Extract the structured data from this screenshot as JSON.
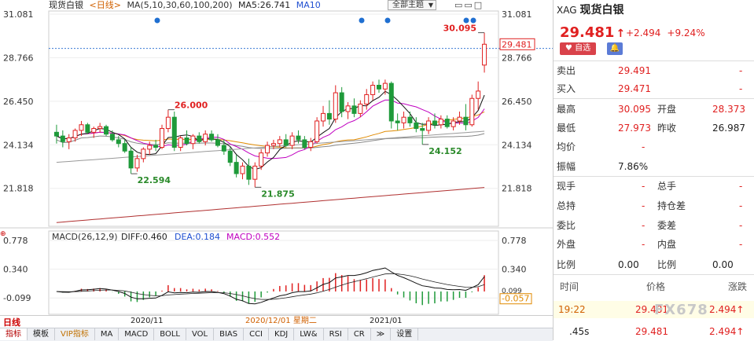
{
  "header": {
    "title": "现货白银",
    "period": "<日线>",
    "ma_label": "MA(5,10,30,60,100,200)",
    "ma5": "MA5:26.741",
    "ma10": "MA10",
    "theme_button": "全部主题",
    "window_buttons": "▭▭□"
  },
  "macd": {
    "label": "MACD(26,12,9)",
    "dif": "DIFF:0.460",
    "dea": "DEA:0.184",
    "macd": "MACD:0.552",
    "axis_ticks": [
      "0.778",
      "0.340",
      "-0.099"
    ],
    "right_ticks": [
      "0.778",
      "0.340",
      "0.099",
      "-0.057"
    ]
  },
  "chart_data": {
    "type": "candlestick",
    "y_ticks_left": [
      "31.081",
      "28.766",
      "26.450",
      "24.134",
      "21.818"
    ],
    "y_ticks_right": [
      "31.081",
      "28.766",
      "26.450",
      "24.134",
      "21.818"
    ],
    "ylim": [
      19.8,
      31.081
    ],
    "current_price_tag": "29.481",
    "annotations": [
      {
        "text": "30.095",
        "color": "#e02020"
      },
      {
        "text": "26.000",
        "color": "#e02020"
      },
      {
        "text": "22.594",
        "color": "#2a8a2a"
      },
      {
        "text": "21.875",
        "color": "#2a8a2a"
      },
      {
        "text": "24.152",
        "color": "#2a8a2a"
      }
    ],
    "x_labels": [
      "2020/11",
      "2020/12/01 星期二",
      "2021/01"
    ],
    "candles": [
      [
        24.8,
        25.2,
        24.2,
        24.6
      ],
      [
        24.6,
        24.9,
        24.0,
        24.3
      ],
      [
        24.3,
        24.7,
        23.9,
        24.5
      ],
      [
        24.5,
        25.0,
        24.3,
        24.9
      ],
      [
        24.9,
        25.4,
        24.6,
        25.2
      ],
      [
        25.2,
        25.3,
        24.7,
        24.8
      ],
      [
        24.8,
        25.1,
        24.5,
        25.0
      ],
      [
        25.0,
        25.3,
        24.8,
        25.1
      ],
      [
        25.1,
        25.2,
        24.6,
        24.7
      ],
      [
        24.7,
        24.9,
        24.3,
        24.4
      ],
      [
        24.4,
        24.6,
        24.0,
        24.2
      ],
      [
        24.2,
        24.4,
        23.7,
        23.8
      ],
      [
        23.8,
        24.0,
        22.6,
        22.9
      ],
      [
        22.9,
        23.6,
        22.7,
        23.4
      ],
      [
        23.4,
        24.0,
        23.2,
        23.9
      ],
      [
        23.9,
        24.3,
        23.6,
        24.1
      ],
      [
        24.1,
        24.4,
        23.8,
        24.0
      ],
      [
        24.0,
        25.2,
        23.9,
        25.0
      ],
      [
        25.0,
        26.0,
        24.8,
        25.6
      ],
      [
        25.6,
        25.9,
        23.8,
        24.0
      ],
      [
        24.0,
        24.6,
        23.8,
        24.5
      ],
      [
        24.5,
        24.9,
        24.1,
        24.2
      ],
      [
        24.2,
        24.7,
        23.9,
        24.6
      ],
      [
        24.6,
        24.8,
        24.2,
        24.3
      ],
      [
        24.3,
        24.9,
        24.1,
        24.7
      ],
      [
        24.7,
        24.9,
        24.3,
        24.4
      ],
      [
        24.4,
        24.7,
        24.0,
        24.1
      ],
      [
        24.1,
        24.4,
        23.6,
        23.8
      ],
      [
        23.8,
        24.0,
        23.0,
        23.2
      ],
      [
        23.2,
        23.6,
        22.4,
        22.6
      ],
      [
        22.6,
        23.2,
        22.3,
        23.0
      ],
      [
        23.0,
        23.4,
        22.0,
        22.3
      ],
      [
        22.3,
        23.2,
        21.875,
        23.0
      ],
      [
        23.0,
        23.9,
        22.8,
        23.7
      ],
      [
        23.7,
        24.3,
        23.5,
        24.1
      ],
      [
        24.1,
        24.4,
        23.9,
        24.2
      ],
      [
        24.2,
        24.6,
        24.0,
        24.4
      ],
      [
        24.4,
        24.7,
        24.0,
        24.1
      ],
      [
        24.1,
        24.8,
        23.9,
        24.6
      ],
      [
        24.6,
        24.9,
        24.2,
        24.4
      ],
      [
        24.4,
        24.6,
        23.9,
        24.0
      ],
      [
        24.0,
        24.5,
        23.8,
        24.3
      ],
      [
        24.3,
        25.6,
        24.2,
        25.4
      ],
      [
        25.4,
        26.2,
        25.1,
        25.8
      ],
      [
        25.8,
        26.5,
        25.2,
        25.5
      ],
      [
        25.5,
        27.3,
        25.3,
        26.9
      ],
      [
        26.9,
        27.2,
        25.6,
        25.9
      ],
      [
        25.9,
        26.4,
        25.5,
        26.2
      ],
      [
        26.2,
        26.6,
        25.6,
        25.8
      ],
      [
        25.8,
        26.5,
        25.6,
        26.3
      ],
      [
        26.3,
        27.1,
        26.0,
        26.8
      ],
      [
        26.8,
        27.5,
        26.5,
        27.3
      ],
      [
        27.3,
        27.6,
        26.9,
        27.1
      ],
      [
        27.1,
        27.6,
        26.8,
        27.4
      ],
      [
        27.4,
        27.5,
        25.0,
        25.4
      ],
      [
        25.4,
        25.8,
        24.9,
        25.3
      ],
      [
        25.3,
        25.9,
        25.0,
        25.6
      ],
      [
        25.6,
        25.9,
        25.1,
        25.3
      ],
      [
        25.3,
        25.6,
        24.8,
        25.0
      ],
      [
        25.0,
        25.3,
        24.152,
        24.9
      ],
      [
        24.9,
        25.6,
        24.7,
        25.4
      ],
      [
        25.4,
        25.8,
        25.0,
        25.2
      ],
      [
        25.2,
        25.7,
        25.0,
        25.5
      ],
      [
        25.5,
        25.7,
        25.0,
        25.1
      ],
      [
        25.1,
        25.6,
        24.9,
        25.4
      ],
      [
        25.4,
        25.9,
        25.2,
        25.6
      ],
      [
        25.6,
        26.3,
        24.9,
        25.2
      ],
      [
        25.2,
        26.8,
        25.1,
        26.6
      ],
      [
        26.6,
        27.5,
        26.0,
        26.99
      ],
      [
        28.373,
        30.095,
        27.973,
        29.481
      ]
    ]
  },
  "quote": {
    "code": "XAG",
    "name": "现货白银",
    "price": "29.481",
    "arrow": "↑",
    "change": "+2.494",
    "change_pct": "+9.24%",
    "btn_watch": "♥ 自选",
    "rows": [
      {
        "l1": "卖出",
        "v1": "29.491",
        "l2": "",
        "v2": "-"
      },
      {
        "l1": "买入",
        "v1": "29.471",
        "l2": "",
        "v2": "-"
      },
      {
        "l1": "最高",
        "v1": "30.095",
        "l2": "开盘",
        "v2": "28.373"
      },
      {
        "l1": "最低",
        "v1": "27.973",
        "l2": "昨收",
        "v2": "26.987"
      },
      {
        "l1": "均价",
        "v1": "-",
        "l2": "",
        "v2": ""
      },
      {
        "l1": "振幅",
        "v1": "7.86%",
        "l2": "",
        "v2": ""
      },
      {
        "l1": "现手",
        "v1": "-",
        "l2": "总手",
        "v2": "-"
      },
      {
        "l1": "总持",
        "v1": "-",
        "l2": "持仓差",
        "v2": "-"
      },
      {
        "l1": "委比",
        "v1": "-",
        "l2": "委差",
        "v2": "-"
      },
      {
        "l1": "外盘",
        "v1": "-",
        "l2": "内盘",
        "v2": "-"
      },
      {
        "l1": "比例",
        "v1": "0.00",
        "l2": "比例",
        "v2": "0.00"
      }
    ],
    "tick_header": {
      "time": "时间",
      "price": "价格",
      "change": "涨跌"
    },
    "ticks": [
      {
        "time": "19:22",
        "price": "29.481",
        "change": "2.494↑"
      },
      {
        "time": ".45s",
        "price": "29.481",
        "change": "2.494↑"
      }
    ]
  },
  "footer": {
    "tag": "日线",
    "tabs": [
      "指标",
      "模板",
      "VIP指标",
      "MA",
      "MACD",
      "BOLL",
      "VOL",
      "BIAS",
      "CCI",
      "KDJ",
      "LW&",
      "RSI",
      "CR",
      "≫",
      "设置"
    ]
  },
  "watermark": "FX678"
}
